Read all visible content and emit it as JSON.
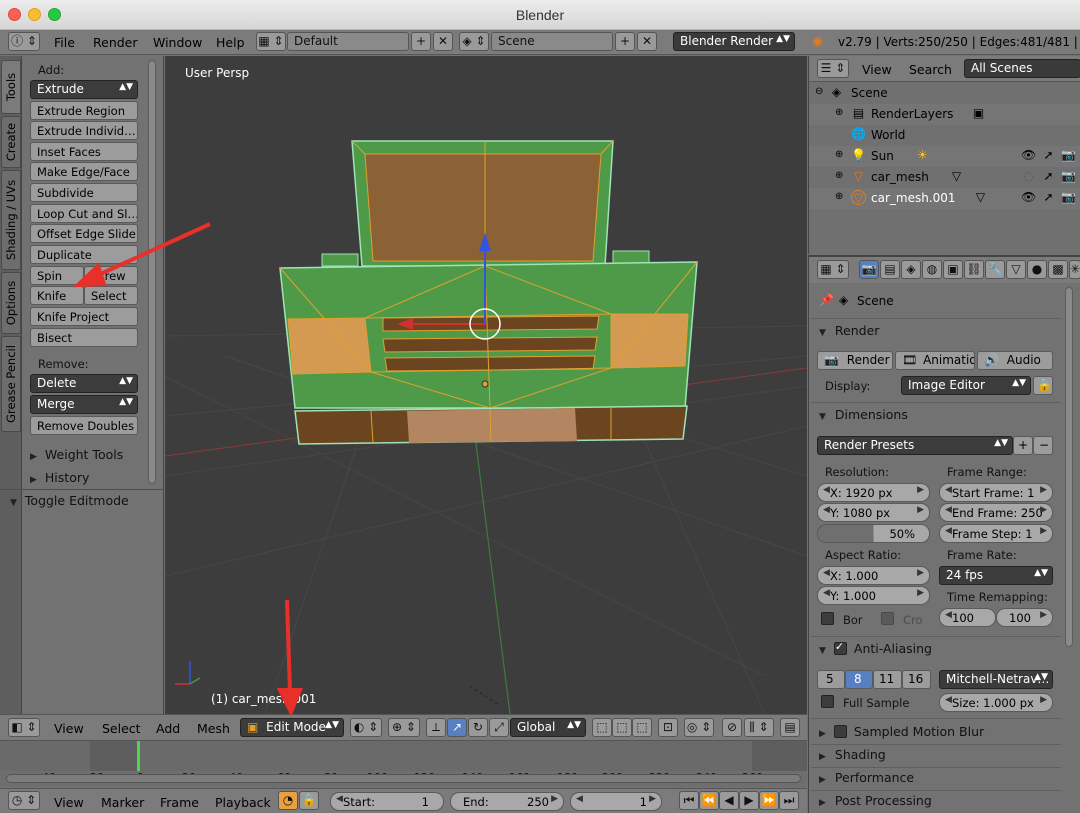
{
  "window": {
    "title": "Blender"
  },
  "info_header": {
    "menus": [
      "File",
      "Render",
      "Window",
      "Help"
    ],
    "layout": "Default",
    "scene": "Scene",
    "engine": "Blender Render",
    "stats": "v2.79 | Verts:250/250 | Edges:481/481 | Fa"
  },
  "tool_tabs": [
    "Tools",
    "Create",
    "Shading / UVs",
    "Options",
    "Grease Pencil"
  ],
  "tools": {
    "add_label": "Add:",
    "extrude": "Extrude",
    "add_buttons": [
      "Extrude Region",
      "Extrude Individ…",
      "Inset Faces",
      "Make Edge/Face",
      "Subdivide",
      "Loop Cut and Sl…",
      "Offset Edge Slide",
      "Duplicate"
    ],
    "spin": "Spin",
    "screw": "Screw",
    "knife": "Knife",
    "select": "Select",
    "knife_project": "Knife Project",
    "bisect": "Bisect",
    "remove_label": "Remove:",
    "delete": "Delete",
    "merge": "Merge",
    "remove_doubles": "Remove Doubles",
    "weight_tools": "Weight Tools",
    "history": "History",
    "toggle_editmode": "Toggle Editmode"
  },
  "viewport": {
    "persp_label": "User Persp",
    "object_label": "(1) car_mesh.001"
  },
  "view3d_header": {
    "menus": [
      "View",
      "Select",
      "Add",
      "Mesh"
    ],
    "mode": "Edit Mode",
    "orientation": "Global"
  },
  "timeline": {
    "ticks": [
      "-40",
      "-20",
      "0",
      "20",
      "40",
      "60",
      "80",
      "100",
      "120",
      "140",
      "160",
      "180",
      "200",
      "220",
      "240",
      "260"
    ],
    "current_frame_marker": 0
  },
  "timeline_header": {
    "menus": [
      "View",
      "Marker",
      "Frame",
      "Playback"
    ],
    "start_label": "Start:",
    "start_value": "1",
    "end_label": "End:",
    "end_value": "250",
    "current_value": "1"
  },
  "outliner": {
    "header": {
      "view": "View",
      "search": "Search",
      "filter": "All Scenes"
    },
    "items": [
      {
        "name": "Scene"
      },
      {
        "name": "RenderLayers"
      },
      {
        "name": "World"
      },
      {
        "name": "Sun"
      },
      {
        "name": "car_mesh"
      },
      {
        "name": "car_mesh.001"
      }
    ]
  },
  "properties": {
    "context": "Scene",
    "render": {
      "title": "Render",
      "buttons": [
        "Render",
        "Animation",
        "Audio"
      ],
      "display_label": "Display:",
      "display_value": "Image Editor"
    },
    "dimensions": {
      "title": "Dimensions",
      "presets": "Render Presets",
      "resolution_label": "Resolution:",
      "res_x": "X:      1920 px",
      "res_y": "Y:      1080 px",
      "res_pct": "50%",
      "frame_range_label": "Frame Range:",
      "start_frame": "Start Frame:  1",
      "end_frame": "End Frame: 250",
      "frame_step": "Frame Step:  1",
      "aspect_label": "Aspect Ratio:",
      "aspect_x": "X:        1.000",
      "aspect_y": "Y:        1.000",
      "frame_rate_label": "Frame Rate:",
      "frame_rate": "24 fps",
      "time_remap_label": "Time Remapping:",
      "remap_old": "100",
      "remap_new": "100",
      "border": "Bor",
      "crop": "Cro"
    },
    "anti_aliasing": {
      "title": "Anti-Aliasing",
      "samples": [
        "5",
        "8",
        "11",
        "16"
      ],
      "selected_sample": "8",
      "filter": "Mitchell-Netrav…",
      "full_sample": "Full Sample",
      "size": "Size:  1.000 px"
    },
    "collapsed": [
      "Sampled Motion Blur",
      "Shading",
      "Performance",
      "Post Processing"
    ]
  },
  "colors": {
    "accent_blue": "#5680c2",
    "mesh_green": "#4e9a48",
    "mesh_orange": "#d49a52",
    "mesh_brown": "#6b4520",
    "annotation_red": "#e8302a"
  }
}
